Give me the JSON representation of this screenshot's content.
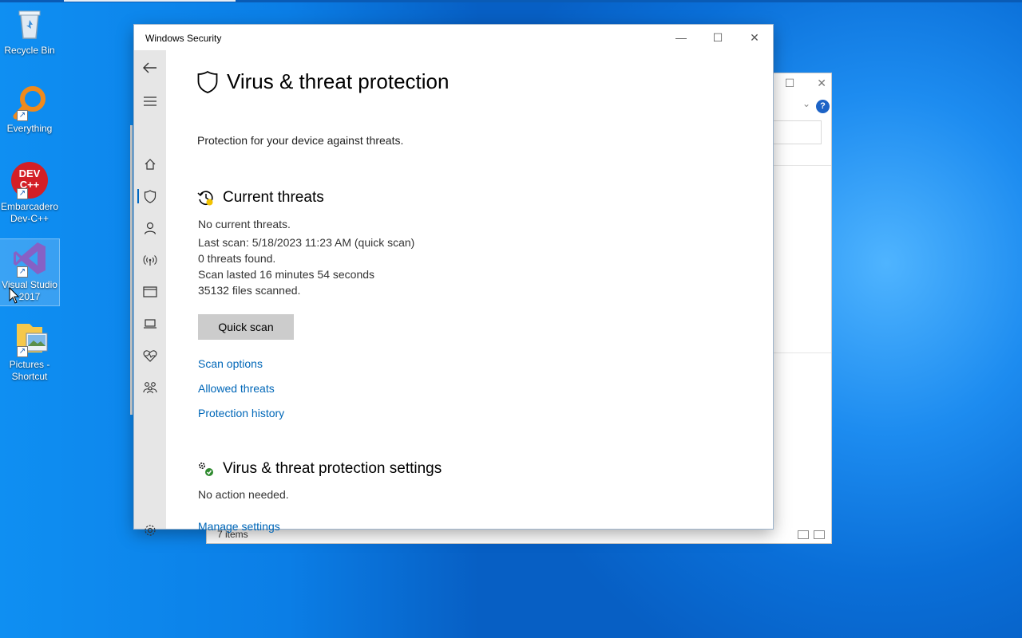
{
  "desktop": {
    "icons": [
      {
        "label": "Recycle Bin"
      },
      {
        "label": "Everything"
      },
      {
        "label": "Embarcadero Dev-C++",
        "badge": "DEV C++"
      },
      {
        "label": "Visual Studio 2017"
      },
      {
        "label": "Pictures - Shortcut"
      }
    ]
  },
  "explorer": {
    "status": "7 items",
    "help_glyph": "?"
  },
  "window": {
    "title": "Windows Security",
    "controls": {
      "minimize": "—",
      "maximize": "☐",
      "close": "✕"
    }
  },
  "page": {
    "title": "Virus & threat protection",
    "subtitle": "Protection for your device against threats."
  },
  "current_threats": {
    "title": "Current threats",
    "status": "No current threats.",
    "last_scan": "Last scan: 5/18/2023 11:23 AM (quick scan)",
    "threats_found": "0 threats found.",
    "duration": "Scan lasted 16 minutes 54 seconds",
    "files_scanned": "35132 files scanned.",
    "quick_scan_button": "Quick scan",
    "links": {
      "scan_options": "Scan options",
      "allowed_threats": "Allowed threats",
      "protection_history": "Protection history"
    }
  },
  "settings": {
    "title": "Virus & threat protection settings",
    "status": "No action needed.",
    "manage_link": "Manage settings"
  },
  "colors": {
    "link": "#0067b8",
    "nav_bg": "#e6e6e6",
    "button_bg": "#cccccc",
    "desktop": "#0a6fd8"
  }
}
